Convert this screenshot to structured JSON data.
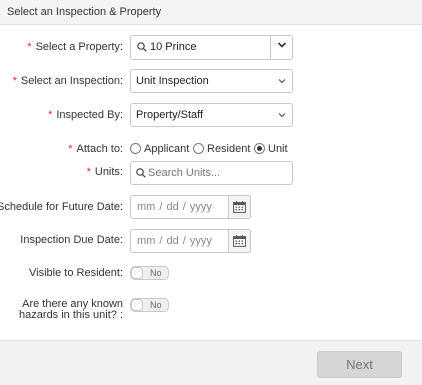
{
  "header": {
    "title": "Select an Inspection & Property"
  },
  "property": {
    "label": "Select a Property:",
    "value": "10 Prince"
  },
  "inspection": {
    "label": "Select an Inspection:",
    "value": "Unit Inspection"
  },
  "inspected_by": {
    "label": "Inspected By:",
    "value": "Property/Staff"
  },
  "attach_to": {
    "label": "Attach to:",
    "options": [
      "Applicant",
      "Resident",
      "Unit"
    ],
    "selected": "Unit"
  },
  "units": {
    "label": "Units:",
    "placeholder": "Search Units..."
  },
  "schedule_date": {
    "label": "Schedule for Future Date:",
    "placeholder": "mm / dd / yyyy"
  },
  "due_date": {
    "label": "Inspection Due Date:",
    "placeholder": "mm / dd / yyyy"
  },
  "visible_to_resident": {
    "label": "Visible to Resident:",
    "value": "No"
  },
  "hazards": {
    "label_line1": "Are there any known",
    "label_line2": "hazards in this unit? :",
    "value": "No"
  },
  "footer": {
    "next_label": "Next"
  },
  "required_marker": "*",
  "colors": {
    "required": "#d9302c",
    "header_bg": "#f4f4f4",
    "footer_bg": "#f2f2f2",
    "button_disabled_bg": "#d6d6d6"
  },
  "icons": [
    "magnifier-icon",
    "chevron-down-icon",
    "calendar-icon"
  ]
}
